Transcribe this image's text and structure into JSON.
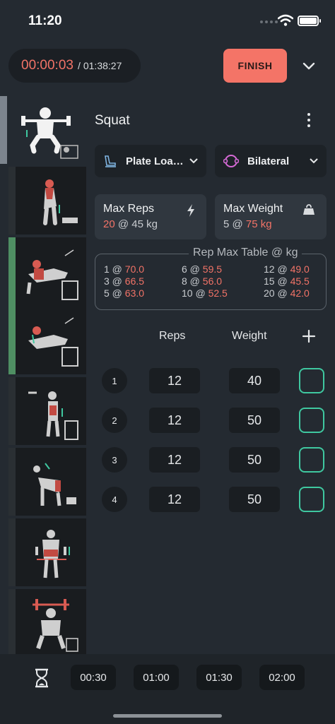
{
  "status_bar": {
    "time": "11:20"
  },
  "timer": {
    "elapsed": "00:00:03",
    "separator": "/",
    "total": "01:38:27"
  },
  "finish_label": "FINISH",
  "exercise": {
    "name": "Squat",
    "equipment": "Plate Loa…",
    "side": "Bilateral",
    "max_reps": {
      "title": "Max Reps",
      "value": "20",
      "at": "@",
      "weight": "45 kg"
    },
    "max_weight": {
      "title": "Max Weight",
      "reps": "5",
      "at": "@",
      "value": "75 kg"
    }
  },
  "rep_max_table": {
    "title": "Rep Max Table @ kg",
    "entries": [
      {
        "reps": "1 @",
        "weight": "70.0"
      },
      {
        "reps": "6 @",
        "weight": "59.5"
      },
      {
        "reps": "12 @",
        "weight": "49.0"
      },
      {
        "reps": "3 @",
        "weight": "66.5"
      },
      {
        "reps": "8 @",
        "weight": "56.0"
      },
      {
        "reps": "15 @",
        "weight": "45.5"
      },
      {
        "reps": "5 @",
        "weight": "63.0"
      },
      {
        "reps": "10 @",
        "weight": "52.5"
      },
      {
        "reps": "20 @",
        "weight": "42.0"
      }
    ]
  },
  "sets_header": {
    "reps": "Reps",
    "weight": "Weight",
    "add": "+"
  },
  "sets": [
    {
      "num": "1",
      "reps": "12",
      "weight": "40"
    },
    {
      "num": "2",
      "reps": "12",
      "weight": "50"
    },
    {
      "num": "3",
      "reps": "12",
      "weight": "50"
    },
    {
      "num": "4",
      "reps": "12",
      "weight": "50"
    }
  ],
  "rest_timers": [
    "00:30",
    "01:00",
    "01:30",
    "02:00"
  ],
  "colors": {
    "accent": "#f47467",
    "check": "#3fc8a0",
    "superset": "#4f8f63",
    "active": "#7d858e"
  }
}
